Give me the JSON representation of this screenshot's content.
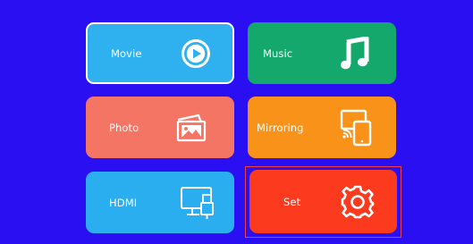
{
  "menu": {
    "tiles": [
      {
        "id": "movie",
        "label": "Movie",
        "icon": "play-circle-icon",
        "color": "#2fb1f0",
        "selected": true
      },
      {
        "id": "music",
        "label": "Music",
        "icon": "music-note-icon",
        "color": "#15a86c"
      },
      {
        "id": "photo",
        "label": "Photo",
        "icon": "photo-gallery-icon",
        "color": "#f57565"
      },
      {
        "id": "mirroring",
        "label": "Mirroring",
        "icon": "screen-mirroring-icon",
        "color": "#f99219"
      },
      {
        "id": "hdmi",
        "label": "HDMI",
        "icon": "hdmi-monitor-icon",
        "color": "#2aaeef"
      },
      {
        "id": "set",
        "label": "Set",
        "icon": "gear-icon",
        "color": "#fb3a1e",
        "focused": true
      }
    ]
  },
  "colors": {
    "background": "#2a0ff2",
    "focus_frame": "#ee3f4a",
    "selected_border": "#ffffff"
  }
}
